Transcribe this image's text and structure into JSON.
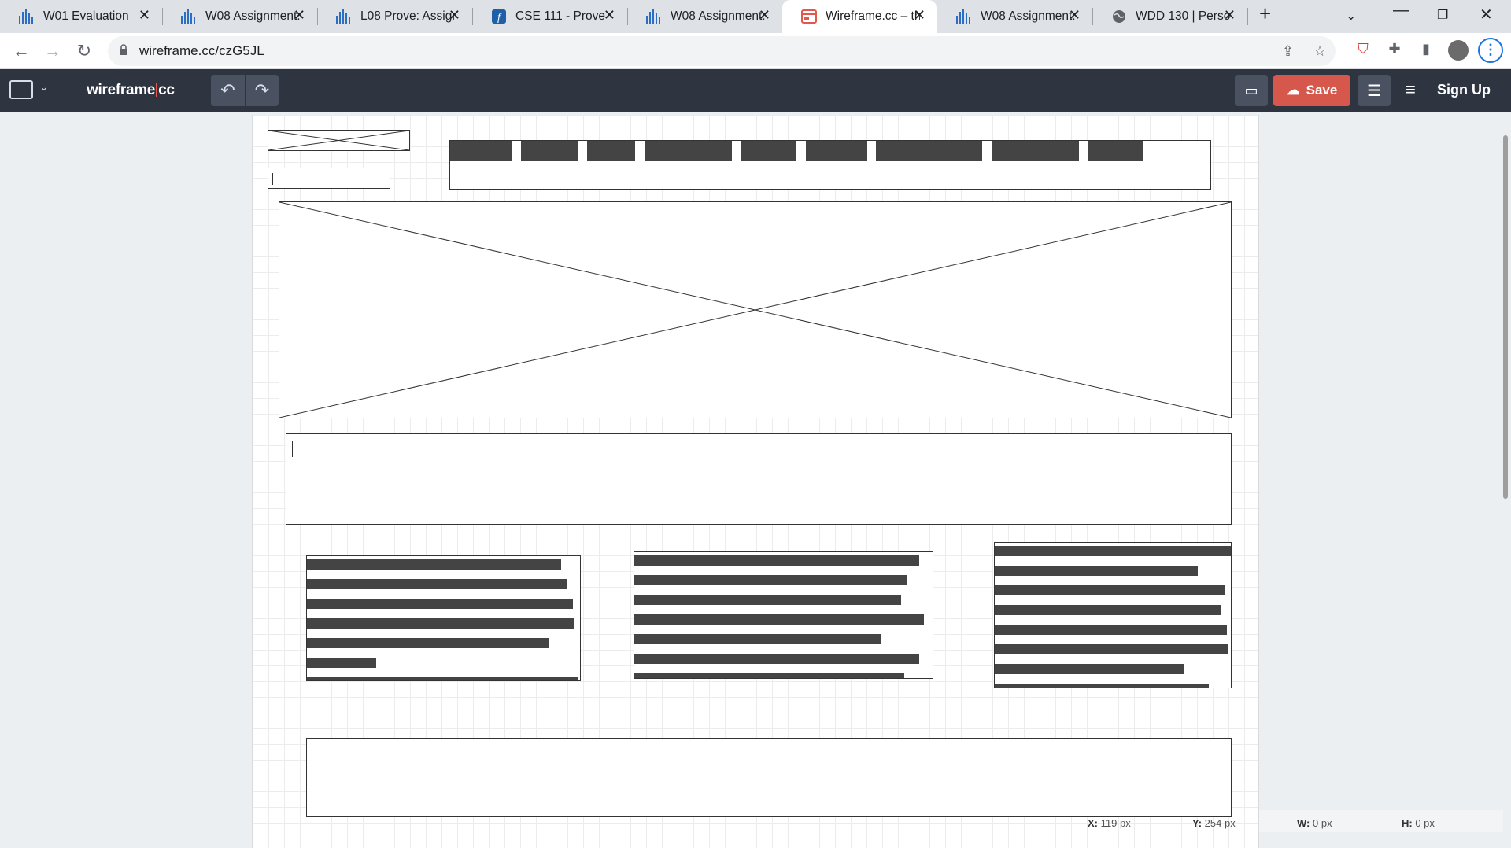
{
  "browser": {
    "tabs": [
      {
        "title": "W01 Evaluation",
        "icon": "canvas-bars-icon"
      },
      {
        "title": "W08 Assignment:",
        "icon": "canvas-bars-icon"
      },
      {
        "title": "L08 Prove: Assign",
        "icon": "canvas-bars-icon"
      },
      {
        "title": "CSE 111 - Prove",
        "icon": "f-logo-icon"
      },
      {
        "title": "W08 Assignment:",
        "icon": "canvas-bars-icon"
      },
      {
        "title": "Wireframe.cc – th",
        "icon": "wireframe-icon",
        "active": true
      },
      {
        "title": "W08 Assignment:",
        "icon": "canvas-bars-icon"
      },
      {
        "title": "WDD 130 | Persor",
        "icon": "globe-icon"
      }
    ],
    "url": "wireframe.cc/czG5JL"
  },
  "app": {
    "logo_main": "wireframe",
    "logo_suffix": "cc",
    "save_label": "Save",
    "signup_label": "Sign Up",
    "accent": "#d6584d",
    "toolbar_bg": "#2e3440"
  },
  "status": {
    "x_label": "X:",
    "x_value": "119 px",
    "y_label": "Y:",
    "y_value": "254 px",
    "w_label": "W:",
    "w_value": "0 px",
    "h_label": "H:",
    "h_value": "0 px"
  }
}
